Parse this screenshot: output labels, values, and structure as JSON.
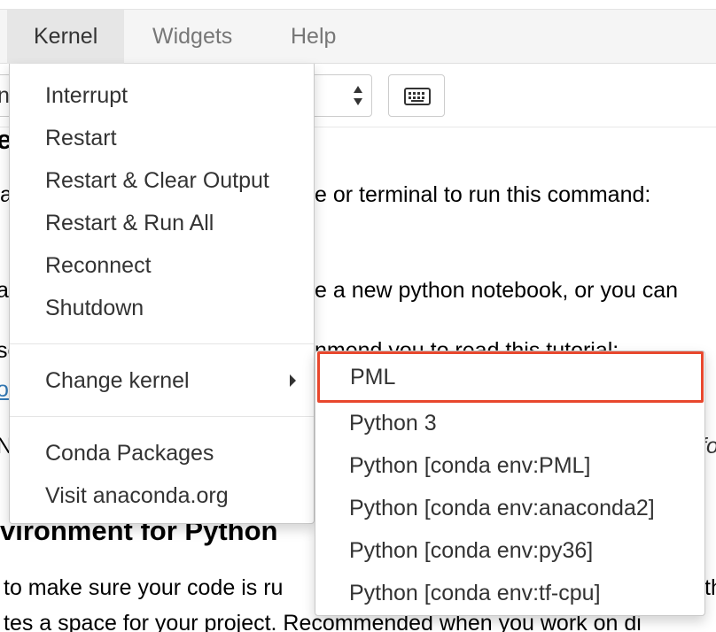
{
  "menubar": {
    "items": [
      {
        "label": "Kernel",
        "active": true
      },
      {
        "label": "Widgets",
        "active": false
      },
      {
        "label": "Help",
        "active": false
      }
    ]
  },
  "toolbar": {
    "cell_type_select": {
      "value": "n"
    },
    "keyboard_icon": "keyboard-icon"
  },
  "notebook": {
    "lines": [
      "er",
      "a",
      "e or terminal to run this command:",
      "ar",
      "e a new python notebook, or you can",
      "se",
      "nmend you to read this tutorial:",
      "o",
      "N",
      "fo",
      "vironment for Python",
      "to make sure your code is ru",
      "th",
      "tes a space for your project. Recommended when you work on di"
    ]
  },
  "kernel_menu": {
    "items": [
      {
        "label": "Interrupt"
      },
      {
        "label": "Restart"
      },
      {
        "label": "Restart & Clear Output"
      },
      {
        "label": "Restart & Run All"
      },
      {
        "label": "Reconnect"
      },
      {
        "label": "Shutdown"
      },
      {
        "label": "Change kernel",
        "has_submenu": true
      },
      {
        "label": "Conda Packages"
      },
      {
        "label": "Visit anaconda.org"
      }
    ]
  },
  "change_kernel_submenu": {
    "highlight_color": "#e8472d",
    "items": [
      {
        "label": "PML",
        "highlighted": true
      },
      {
        "label": "Python 3"
      },
      {
        "label": "Python [conda env:PML]"
      },
      {
        "label": "Python [conda env:anaconda2]"
      },
      {
        "label": "Python [conda env:py36]"
      },
      {
        "label": "Python [conda env:tf-cpu]"
      }
    ]
  }
}
